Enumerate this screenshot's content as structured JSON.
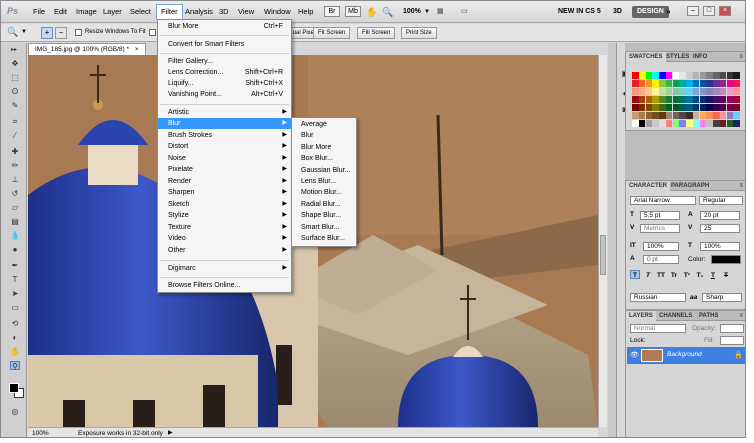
{
  "app": {
    "logo": "Ps"
  },
  "menubar": {
    "items": [
      "File",
      "Edit",
      "Image",
      "Layer",
      "Select",
      "Filter",
      "Analysis",
      "3D",
      "View",
      "Window",
      "Help"
    ],
    "active": "Filter",
    "zoom": "100%",
    "new_in": "NEW IN CS 5",
    "three_d": "3D",
    "design": "DESIGN",
    "win_min": "–",
    "win_max": "□",
    "win_close": "×"
  },
  "options": {
    "resize_label": "Resize Windows To Fit",
    "zoom_all_label": "Zoom All Windows",
    "actual_pixels": "Actual Pixels",
    "fit_screen": "Fit Screen",
    "fill_screen": "Fill Screen",
    "print_size": "Print Size"
  },
  "document": {
    "tab": "IMG_185.jpg @ 100% (RGB/8) *",
    "zoom": "100%",
    "status": "Exposure works in 32-bit only"
  },
  "filter_menu": {
    "top": [
      {
        "label": "Blur More",
        "shortcut": "Ctrl+F"
      }
    ],
    "convert": "Convert for Smart Filters",
    "group2": [
      {
        "label": "Filter Gallery...",
        "shortcut": ""
      },
      {
        "label": "Lens Correction...",
        "shortcut": "Shift+Ctrl+R"
      },
      {
        "label": "Liquify...",
        "shortcut": "Shift+Ctrl+X"
      },
      {
        "label": "Vanishing Point...",
        "shortcut": "Alt+Ctrl+V"
      }
    ],
    "submenus": [
      "Artistic",
      "Blur",
      "Brush Strokes",
      "Distort",
      "Noise",
      "Pixelate",
      "Render",
      "Sharpen",
      "Sketch",
      "Stylize",
      "Texture",
      "Video",
      "Other"
    ],
    "highlighted": "Blur",
    "digimarc": "Digimarc",
    "browse": "Browse Filters Online..."
  },
  "blur_menu": {
    "items": [
      "Average",
      "Blur",
      "Blur More",
      "Box Blur...",
      "Gaussian Blur...",
      "Lens Blur...",
      "Motion Blur...",
      "Radial Blur...",
      "Shape Blur...",
      "Smart Blur...",
      "Surface Blur..."
    ]
  },
  "swatches_panel": {
    "tabs": [
      "SWATCHES",
      "STYLES",
      "INFO"
    ],
    "colors": [
      [
        "#ff0000",
        "#ffff00",
        "#00ff00",
        "#00ffff",
        "#0000ff",
        "#ff00ff",
        "#ffffff",
        "#e6e6e6",
        "#cccccc",
        "#b3b3b3",
        "#999999",
        "#808080",
        "#666666",
        "#4d4d4d",
        "#333333",
        "#1a1a1a"
      ],
      [
        "#ed1c24",
        "#f26522",
        "#f7941d",
        "#fff200",
        "#8dc63f",
        "#39b54a",
        "#00a651",
        "#00a99d",
        "#00aeef",
        "#0072bc",
        "#0054a6",
        "#2e3192",
        "#662d91",
        "#92278f",
        "#ec008c",
        "#ed145b"
      ],
      [
        "#f7977a",
        "#f9ad81",
        "#fdc68a",
        "#fff79a",
        "#c4df9b",
        "#a3d39c",
        "#82ca9d",
        "#7bcdc8",
        "#6ecff6",
        "#7ea7d8",
        "#8493ca",
        "#8882be",
        "#a187be",
        "#bc8dbf",
        "#f49ac2",
        "#f6989d"
      ],
      [
        "#9e0b0f",
        "#a0410d",
        "#a36209",
        "#aba000",
        "#598527",
        "#1a7b30",
        "#007236",
        "#00746b",
        "#0076a3",
        "#004b80",
        "#003471",
        "#1b1464",
        "#440e62",
        "#630460",
        "#9e005d",
        "#9e0039"
      ],
      [
        "#790000",
        "#7b2e00",
        "#7d4900",
        "#827b00",
        "#406618",
        "#005e20",
        "#005826",
        "#005952",
        "#005b7f",
        "#003663",
        "#002157",
        "#0d004c",
        "#32004b",
        "#4b0049",
        "#7b0046",
        "#7a0026"
      ],
      [
        "#c69c6d",
        "#a67c52",
        "#8c6239",
        "#754c24",
        "#603913",
        "#998675",
        "#736357",
        "#534741",
        "#362f2d",
        "#c7b299",
        "#fbaf5d",
        "#f68e56",
        "#f26c4f",
        "#f5989d",
        "#8781bd",
        "#6dcff6"
      ],
      [
        "#ffffff",
        "#000000",
        "#a0a0a0",
        "#c8c8c8",
        "#e0e0e0",
        "#ff8080",
        "#80ff80",
        "#8080ff",
        "#ffff80",
        "#80ffff",
        "#ff80ff",
        "#c0c0c0",
        "#404040",
        "#602020",
        "#206020",
        "#202060"
      ]
    ]
  },
  "character_panel": {
    "tabs": [
      "CHARACTER",
      "PARAGRAPH"
    ],
    "font_family": "Arial Narrow",
    "font_style": "Regular",
    "font_size": "5.5 pt",
    "leading": "20 pt",
    "kerning": "Metrics",
    "tracking": "25",
    "vscale": "100%",
    "hscale": "100%",
    "baseline": "0 pt",
    "color_label": "Color:",
    "language": "Russian",
    "antialias": "Sharp",
    "aa_label": "aa",
    "type_buttons": [
      "T",
      "T",
      "TT",
      "Tr",
      "T¹",
      "T₁",
      "T",
      "T"
    ]
  },
  "layers_panel": {
    "tabs": [
      "LAYERS",
      "CHANNELS",
      "PATHS"
    ],
    "blend_mode": "Normal",
    "opacity_label": "Opacity:",
    "lock_label": "Lock:",
    "fill_label": "Fill:",
    "layer_name": "Background"
  },
  "colors": {
    "accent": "#3399ff",
    "selection": "#3d80df"
  }
}
